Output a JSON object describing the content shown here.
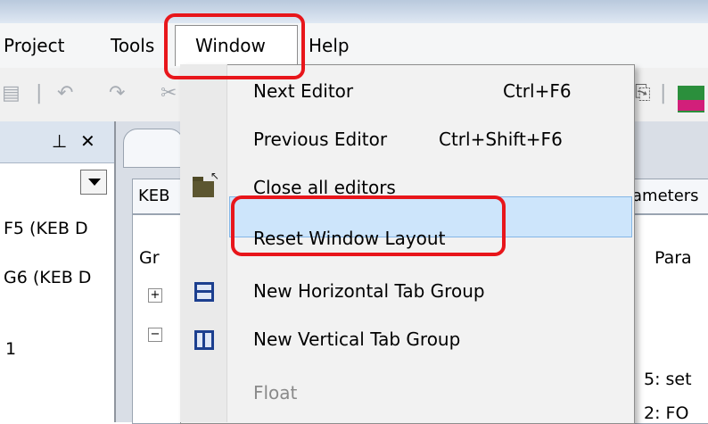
{
  "menubar": {
    "items": [
      {
        "label": "Project",
        "key": "project"
      },
      {
        "label": "Tools",
        "key": "tools"
      },
      {
        "label": "Window",
        "key": "window"
      },
      {
        "label": "Help",
        "key": "help"
      }
    ]
  },
  "left_panel": {
    "pin_glyph": "⊥",
    "close_glyph": "✕",
    "items": [
      "F5 (KEB D",
      "G6 (KEB D",
      "1"
    ]
  },
  "editor": {
    "tab_keb": "KEB",
    "tab_parameters": "ameters",
    "col_group": "Gr",
    "col_param": "Para",
    "row_5": "5: set",
    "row_2": "2: FO",
    "tree_plus": "+",
    "tree_minus": "−"
  },
  "window_menu": {
    "items": [
      {
        "label": "Next Editor",
        "shortcut": "Ctrl+F6",
        "icon": "none"
      },
      {
        "label": "Previous Editor",
        "shortcut": "Ctrl+Shift+F6",
        "icon": "none"
      },
      {
        "label": "Close all editors",
        "shortcut": "",
        "icon": "folder-close-icon"
      },
      {
        "label": "Reset Window Layout",
        "shortcut": "",
        "icon": "none",
        "highlighted": true
      },
      {
        "label": "New Horizontal Tab Group",
        "shortcut": "",
        "icon": "horizontal-split-icon"
      },
      {
        "label": "New Vertical Tab Group",
        "shortcut": "",
        "icon": "vertical-split-icon"
      },
      {
        "label": "Float",
        "shortcut": "",
        "icon": "none",
        "disabled": true
      }
    ]
  },
  "colors": {
    "highlight_bg": "#cde5fb",
    "annotation_red": "#e8161b",
    "disabled_text": "#8a8a8a"
  }
}
